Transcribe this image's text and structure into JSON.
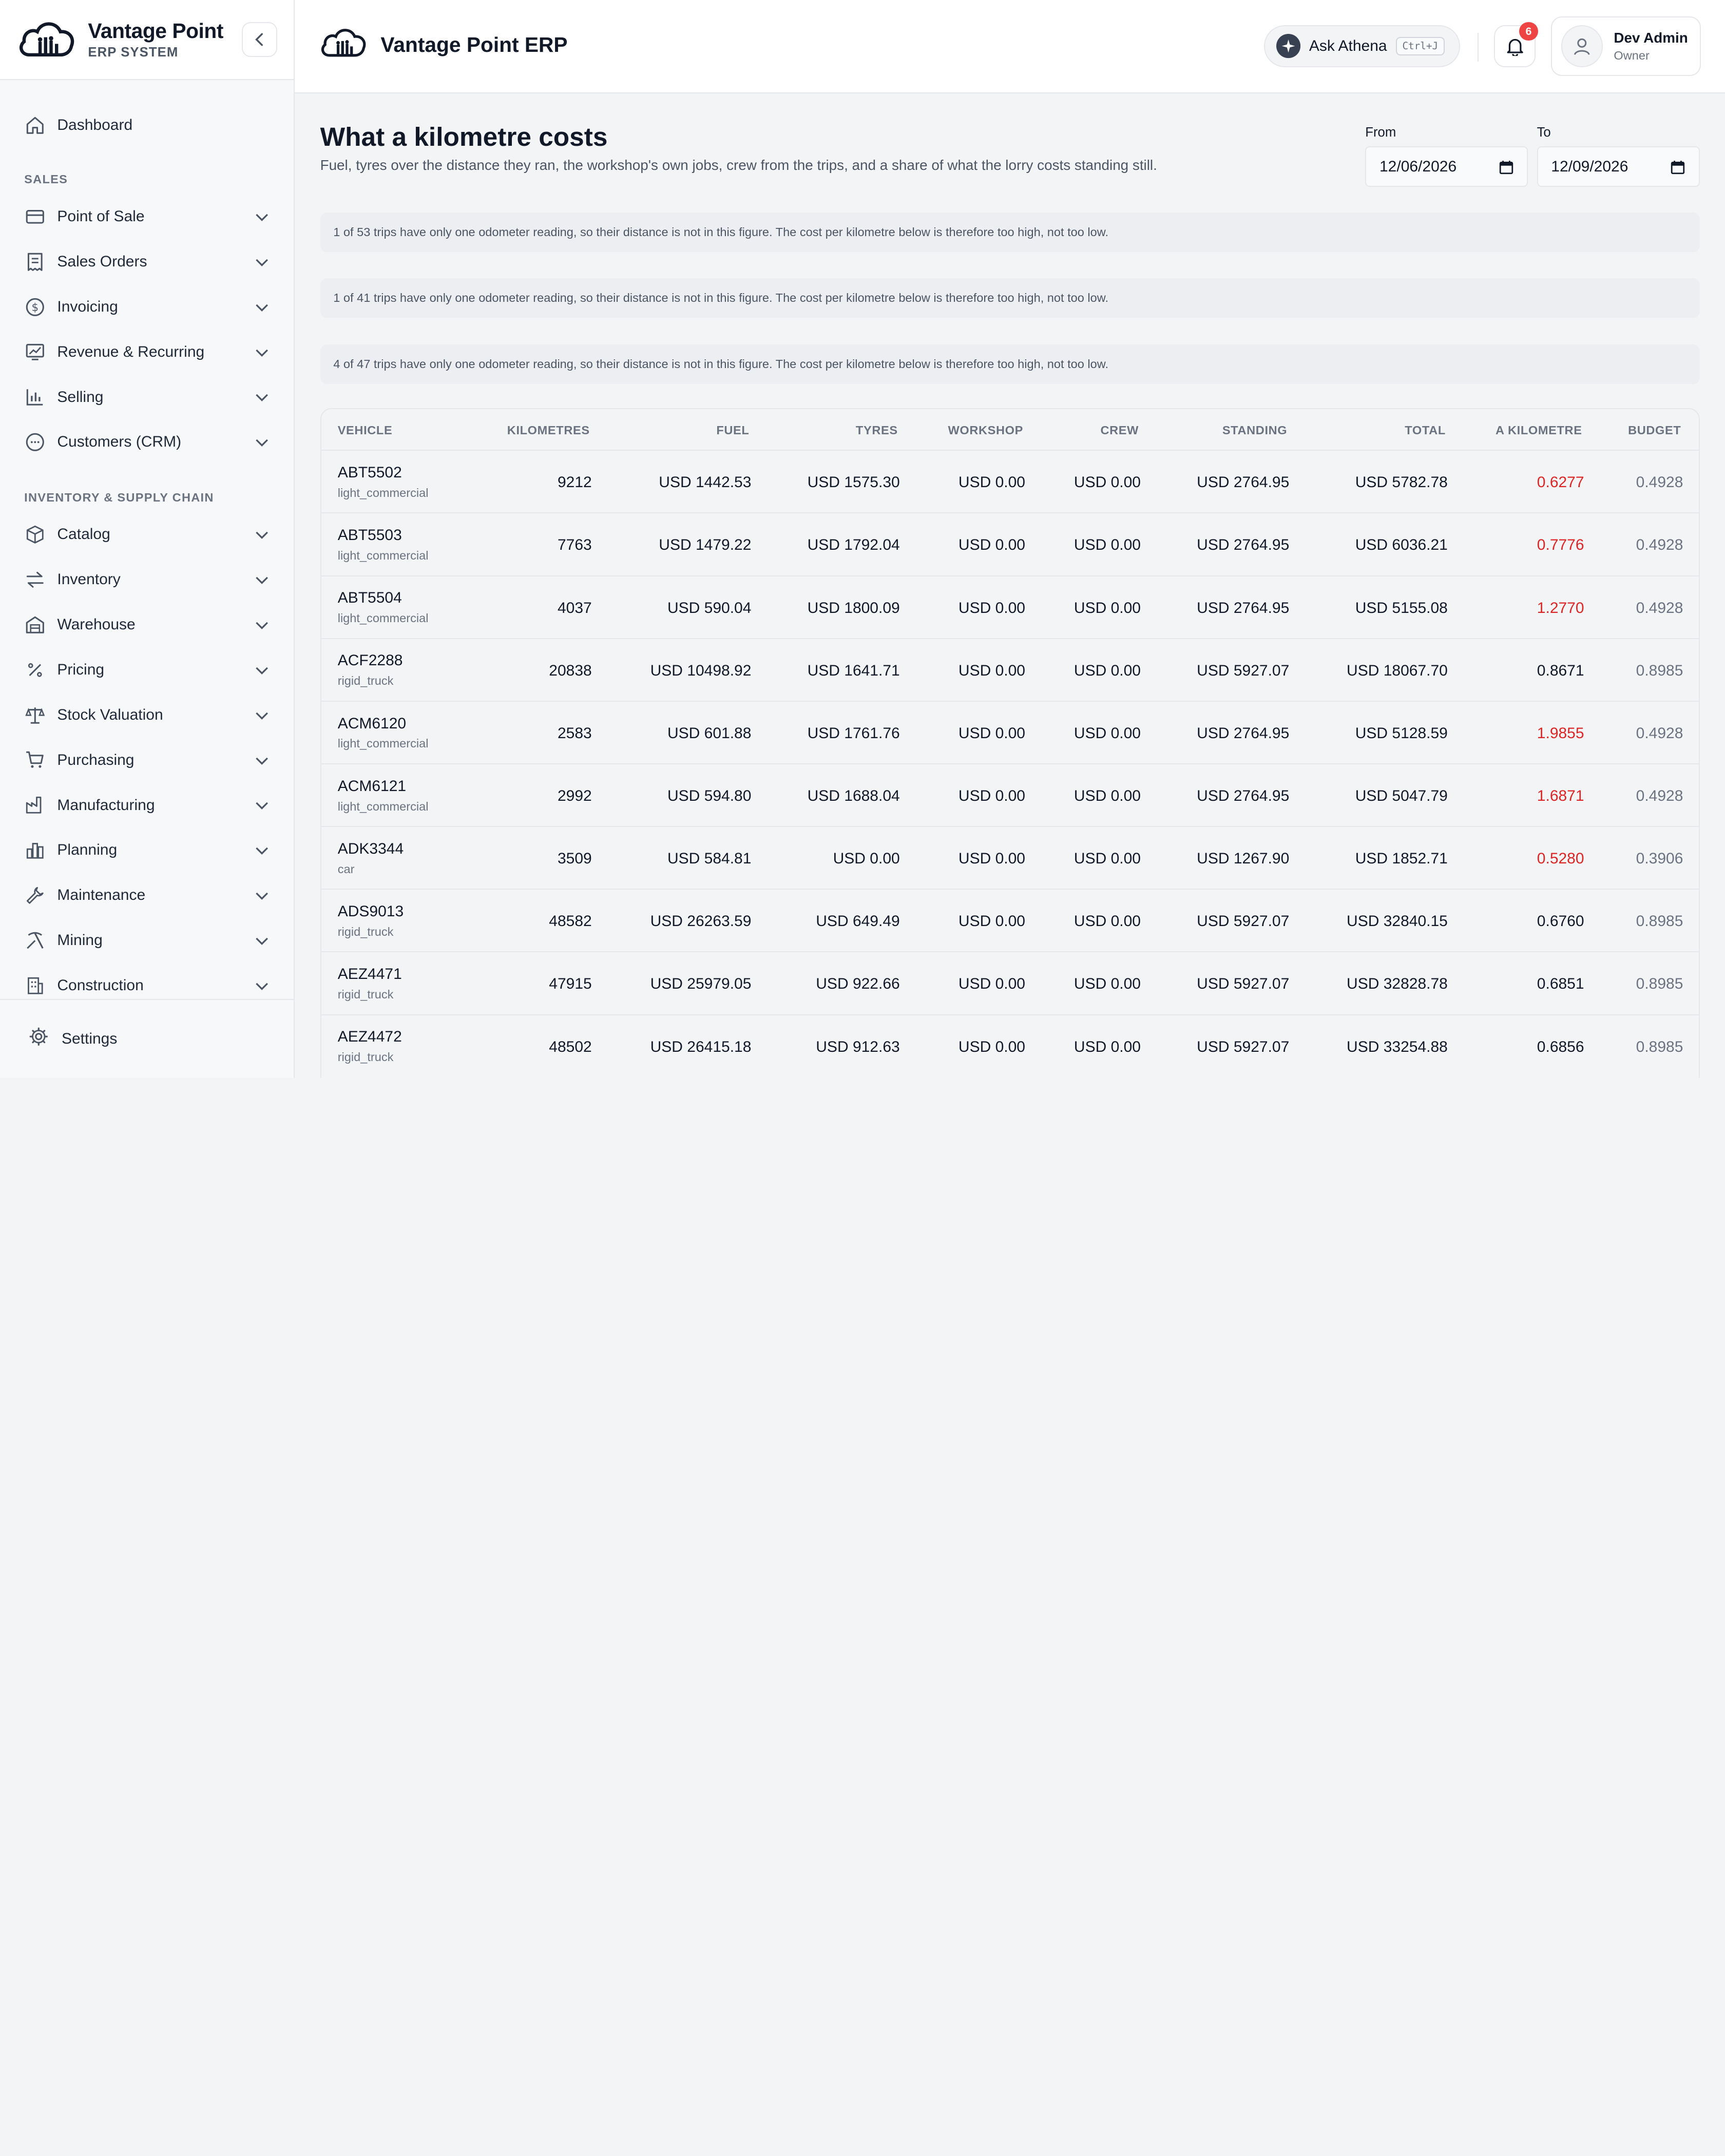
{
  "brand": {
    "name": "Vantage Point",
    "subtitle": "ERP SYSTEM"
  },
  "topbar": {
    "title": "Vantage Point ERP",
    "ask_label": "Ask Athena",
    "ask_shortcut": "Ctrl+J",
    "notification_count": "6",
    "user_name": "Dev Admin",
    "user_role": "Owner"
  },
  "sidebar": {
    "dashboard": "Dashboard",
    "sections": {
      "sales": "SALES",
      "inventory": "INVENTORY & SUPPLY CHAIN"
    },
    "sales_items": [
      "Point of Sale",
      "Sales Orders",
      "Invoicing",
      "Revenue & Recurring",
      "Selling",
      "Customers (CRM)"
    ],
    "inventory_items": [
      "Catalog",
      "Inventory",
      "Warehouse",
      "Pricing",
      "Stock Valuation",
      "Purchasing",
      "Manufacturing",
      "Planning",
      "Maintenance",
      "Mining",
      "Construction"
    ],
    "settings": "Settings"
  },
  "page": {
    "title": "What a kilometre costs",
    "subtitle": "Fuel, tyres over the distance they ran, the workshop's own jobs, crew from the trips, and a share of what the lorry costs standing still.",
    "from_label": "From",
    "from_value": "12/06/2026",
    "to_label": "To",
    "to_value": "12/09/2026"
  },
  "notices": [
    "1 of 53 trips have only one odometer reading, so their distance is not in this figure. The cost per kilometre below is therefore too high, not too low.",
    "1 of 41 trips have only one odometer reading, so their distance is not in this figure. The cost per kilometre below is therefore too high, not too low.",
    "4 of 47 trips have only one odometer reading, so their distance is not in this figure. The cost per kilometre below is therefore too high, not too low."
  ],
  "table": {
    "headers": [
      "VEHICLE",
      "KILOMETRES",
      "FUEL",
      "TYRES",
      "WORKSHOP",
      "CREW",
      "STANDING",
      "TOTAL",
      "A KILOMETRE",
      "BUDGET"
    ],
    "over_budget_color": "#dc2626",
    "rows": [
      {
        "vehicle": "ABT5502",
        "type": "light_commercial",
        "km": "9212",
        "fuel": "USD 1442.53",
        "tyres": "USD 1575.30",
        "workshop": "USD 0.00",
        "crew": "USD 0.00",
        "standing": "USD 2764.95",
        "total": "USD 5782.78",
        "per_km": "0.6277",
        "budget": "0.4928",
        "over": true
      },
      {
        "vehicle": "ABT5503",
        "type": "light_commercial",
        "km": "7763",
        "fuel": "USD 1479.22",
        "tyres": "USD 1792.04",
        "workshop": "USD 0.00",
        "crew": "USD 0.00",
        "standing": "USD 2764.95",
        "total": "USD 6036.21",
        "per_km": "0.7776",
        "budget": "0.4928",
        "over": true
      },
      {
        "vehicle": "ABT5504",
        "type": "light_commercial",
        "km": "4037",
        "fuel": "USD 590.04",
        "tyres": "USD 1800.09",
        "workshop": "USD 0.00",
        "crew": "USD 0.00",
        "standing": "USD 2764.95",
        "total": "USD 5155.08",
        "per_km": "1.2770",
        "budget": "0.4928",
        "over": true
      },
      {
        "vehicle": "ACF2288",
        "type": "rigid_truck",
        "km": "20838",
        "fuel": "USD 10498.92",
        "tyres": "USD 1641.71",
        "workshop": "USD 0.00",
        "crew": "USD 0.00",
        "standing": "USD 5927.07",
        "total": "USD 18067.70",
        "per_km": "0.8671",
        "budget": "0.8985",
        "over": false
      },
      {
        "vehicle": "ACM6120",
        "type": "light_commercial",
        "km": "2583",
        "fuel": "USD 601.88",
        "tyres": "USD 1761.76",
        "workshop": "USD 0.00",
        "crew": "USD 0.00",
        "standing": "USD 2764.95",
        "total": "USD 5128.59",
        "per_km": "1.9855",
        "budget": "0.4928",
        "over": true
      },
      {
        "vehicle": "ACM6121",
        "type": "light_commercial",
        "km": "2992",
        "fuel": "USD 594.80",
        "tyres": "USD 1688.04",
        "workshop": "USD 0.00",
        "crew": "USD 0.00",
        "standing": "USD 2764.95",
        "total": "USD 5047.79",
        "per_km": "1.6871",
        "budget": "0.4928",
        "over": true
      },
      {
        "vehicle": "ADK3344",
        "type": "car",
        "km": "3509",
        "fuel": "USD 584.81",
        "tyres": "USD 0.00",
        "workshop": "USD 0.00",
        "crew": "USD 0.00",
        "standing": "USD 1267.90",
        "total": "USD 1852.71",
        "per_km": "0.5280",
        "budget": "0.3906",
        "over": true
      },
      {
        "vehicle": "ADS9013",
        "type": "rigid_truck",
        "km": "48582",
        "fuel": "USD 26263.59",
        "tyres": "USD 649.49",
        "workshop": "USD 0.00",
        "crew": "USD 0.00",
        "standing": "USD 5927.07",
        "total": "USD 32840.15",
        "per_km": "0.6760",
        "budget": "0.8985",
        "over": false
      },
      {
        "vehicle": "AEZ4471",
        "type": "rigid_truck",
        "km": "47915",
        "fuel": "USD 25979.05",
        "tyres": "USD 922.66",
        "workshop": "USD 0.00",
        "crew": "USD 0.00",
        "standing": "USD 5927.07",
        "total": "USD 32828.78",
        "per_km": "0.6851",
        "budget": "0.8985",
        "over": false
      },
      {
        "vehicle": "AEZ4472",
        "type": "rigid_truck",
        "km": "48502",
        "fuel": "USD 26415.18",
        "tyres": "USD 912.63",
        "workshop": "USD 0.00",
        "crew": "USD 0.00",
        "standing": "USD 5927.07",
        "total": "USD 33254.88",
        "per_km": "0.6856",
        "budget": "0.8985",
        "over": false
      }
    ]
  }
}
